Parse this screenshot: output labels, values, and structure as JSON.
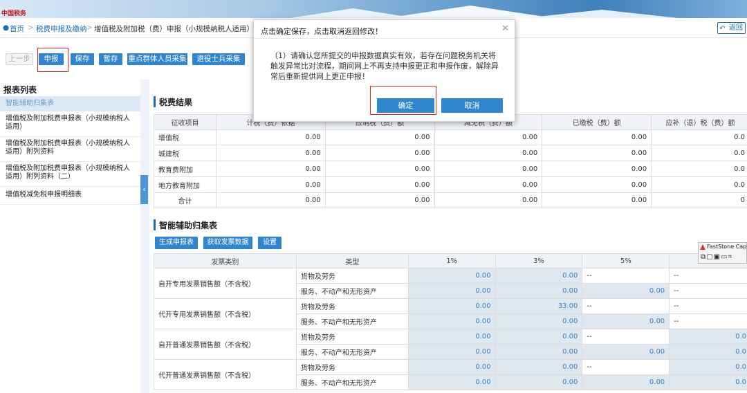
{
  "header": {
    "logo_text": "中国税务"
  },
  "breadcrumb": {
    "home": "首页",
    "sep": ">",
    "level1": "税费申报及缴纳",
    "level2": "增值税及附加税（费）申报（小规模纳税人适用）引导",
    "back": "返回"
  },
  "toolbar": {
    "prev": "上一步",
    "declare": "申报",
    "save": "保存",
    "hold": "暂存",
    "key_group": "重点群体人员采集",
    "veteran": "退役士兵采集"
  },
  "sidebar": {
    "title": "报表列表",
    "items": [
      "智能辅助归集表",
      "增值税及附加税费申报表（小规模纳税人适用）",
      "增值税及附加税费申报表（小规模纳税人适用）附列资料",
      "增值税及附加税费申报表（小规模纳税人适用）附列资料（二）",
      "增值税减免税申报明细表"
    ]
  },
  "tax_result": {
    "title": "税费结果",
    "headers": [
      "征收项目",
      "计税（费）依据",
      "应纳税（费）额",
      "减免税（费）额",
      "已缴税（费）额",
      "应补（退）税（费）额"
    ],
    "rows": [
      {
        "name": "增值税",
        "v": [
          "0.00",
          "0.00",
          "0.00",
          "0.00",
          "0.0"
        ]
      },
      {
        "name": "城建税",
        "v": [
          "0.00",
          "0.00",
          "0.00",
          "0.00",
          "0.0"
        ]
      },
      {
        "name": "教育费附加",
        "v": [
          "0.00",
          "0.00",
          "0.00",
          "0.00",
          "0.0"
        ]
      },
      {
        "name": "地方教育附加",
        "v": [
          "0.00",
          "0.00",
          "0.00",
          "0.00",
          "0.0"
        ]
      },
      {
        "name": "合计",
        "v": [
          "0.00",
          "0.00",
          "0.00",
          "0.00",
          "0"
        ]
      }
    ]
  },
  "smart_table": {
    "title": "智能辅助归集表",
    "buttons": {
      "generate": "生成申报表",
      "fetch": "获取发票数据",
      "settings": "设置"
    },
    "headers": [
      "发票类别",
      "类型",
      "1%",
      "3%",
      "5%",
      ""
    ],
    "type_goods": "货物及劳务",
    "type_service": "服务、不动产和无形资产",
    "dash": "--",
    "groups": [
      {
        "name": "自开专用发票销售额（不含税）",
        "goods": [
          "0.00",
          "0.00",
          "--",
          "--"
        ],
        "service": [
          "0.00",
          "0.00",
          "0.00",
          "--"
        ]
      },
      {
        "name": "代开专用发票销售额（不含税）",
        "goods": [
          "0.00",
          "33.00",
          "--",
          "--"
        ],
        "service": [
          "0.00",
          "0.00",
          "0.00",
          "--"
        ]
      },
      {
        "name": "自开普通发票销售额（不含税）",
        "goods": [
          "0.00",
          "0.00",
          "--",
          "0.0"
        ],
        "service": [
          "0.00",
          "0.00",
          "0.00",
          "0.0"
        ]
      },
      {
        "name": "代开普通发票销售额（不含税）",
        "goods": [
          "0.00",
          "0.00",
          "--",
          "0.0"
        ],
        "service": [
          "0.00",
          "0.00",
          "0.00",
          "0.0"
        ]
      }
    ]
  },
  "faststone": {
    "title": "FastStone Captur"
  },
  "modal": {
    "title": "点击确定保存，点击取消返回修改！",
    "body": "（1）请确认您所提交的申报数据真实有效，若存在问题税务机关将触发异常比对流程，期间网上不再支持申报更正和申报作废，解除异常后重新提供网上更正申报！",
    "ok": "确定",
    "cancel": "取消"
  }
}
